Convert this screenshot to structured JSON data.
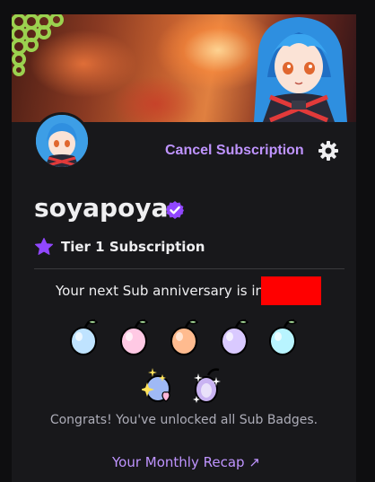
{
  "header": {
    "cancel_label": "Cancel Subscription"
  },
  "channel": {
    "name": "soyapoya"
  },
  "subscription": {
    "tier_label": "Tier 1 Subscription",
    "anniversary_text": "Your next Sub anniversary is in"
  },
  "badges": {
    "row1": [
      {
        "color": "#bfe3ff"
      },
      {
        "color": "#ffc9e4"
      },
      {
        "color": "#ffbb8f"
      },
      {
        "color": "#d9c9ff"
      },
      {
        "color": "#b8f4ff"
      }
    ],
    "congrats_text": "Congrats! You've unlocked all Sub Badges."
  },
  "recap": {
    "label": "Your Monthly Recap ↗"
  },
  "colors": {
    "accent": "#bf94ff",
    "verified": "#9147ff",
    "redaction": "#ff0000"
  }
}
